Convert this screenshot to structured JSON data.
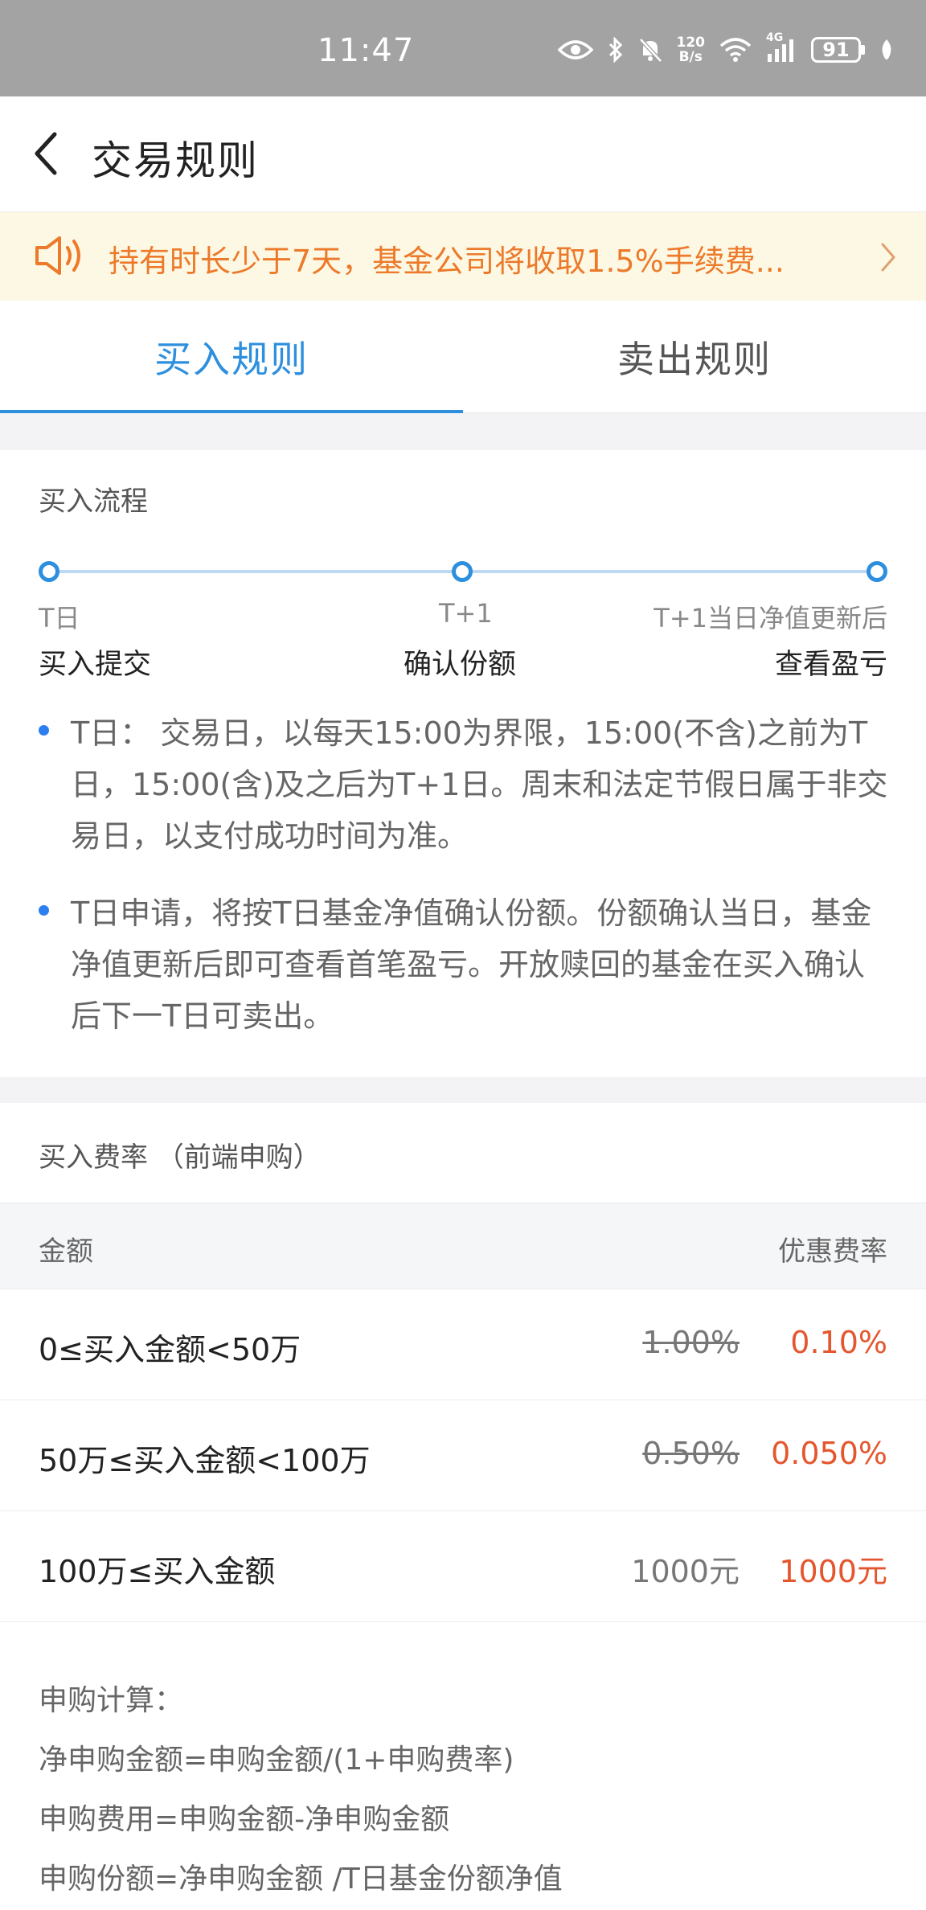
{
  "status_bar": {
    "time": "11:47",
    "net_speed_value": "120",
    "net_speed_unit": "B/s",
    "network_label": "4G",
    "battery": "91",
    "icons": [
      "eye-icon",
      "bluetooth-icon",
      "mute-icon",
      "wifi-icon",
      "signal-icon",
      "battery-icon",
      "leaf-icon"
    ]
  },
  "header": {
    "title": "交易规则",
    "back_icon": "chevron-left-icon"
  },
  "notice": {
    "text": "持有时长少于7天，基金公司将收取1.5%手续费...",
    "color": "#ec7a2a",
    "background": "#fdf8e4"
  },
  "tabs": [
    {
      "label": "买入规则",
      "active": true
    },
    {
      "label": "卖出规则",
      "active": false
    }
  ],
  "accent_color": "#2d8fde",
  "process": {
    "title": "买入流程",
    "steps": [
      {
        "label": "T日",
        "name": "买入提交"
      },
      {
        "label": "T+1",
        "name": "确认份额"
      },
      {
        "label": "T+1当日净值更新后",
        "name": "查看盈亏"
      }
    ],
    "notes": [
      "T日：  交易日，以每天15:00为界限，15:00(不含)之前为T日，15:00(含)及之后为T+1日。周末和法定节假日属于非交易日，以支付成功时间为准。",
      "T日申请，将按T日基金净值确认份额。份额确认当日，基金净值更新后即可查看首笔盈亏。开放赎回的基金在买入确认后下一T日可卖出。"
    ]
  },
  "fee": {
    "title": "买入费率 （前端申购）",
    "header_left": "金额",
    "header_right": "优惠费率",
    "discount_color": "#e4572e",
    "rows": [
      {
        "amount": "0≤买入金额<50万",
        "original": "1.00%",
        "discount": "0.10%",
        "struck": true
      },
      {
        "amount": "50万≤买入金额<100万",
        "original": "0.50%",
        "discount": "0.050%",
        "struck": true
      },
      {
        "amount": "100万≤买入金额",
        "original": "1000元",
        "discount": "1000元",
        "struck": false
      }
    ]
  },
  "calculation": {
    "title": "申购计算：",
    "lines": [
      "净申购金额=申购金额/(1+申购费率)",
      "申购费用=申购金额-净申购金额",
      "申购份额=净申购金额 /T日基金份额净值"
    ]
  }
}
